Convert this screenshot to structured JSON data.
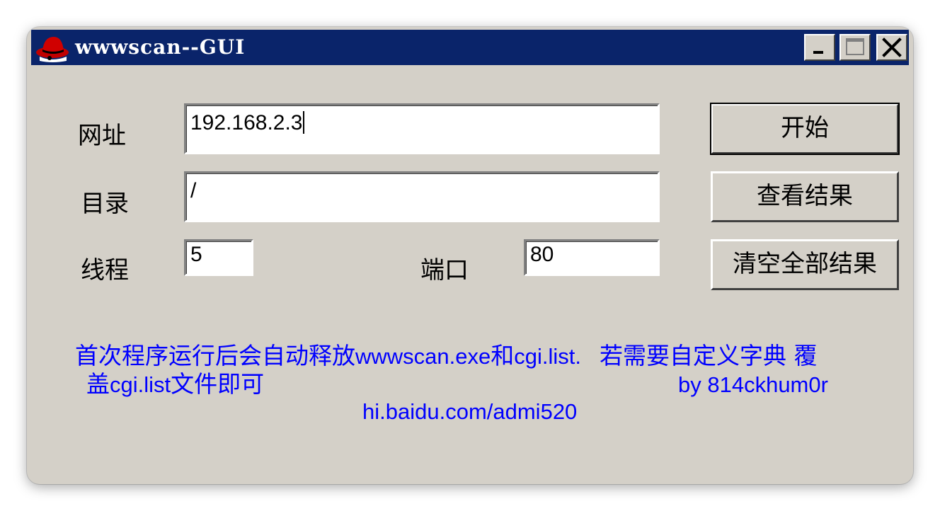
{
  "window": {
    "title": "wwwscan--GUI"
  },
  "form": {
    "url_label": "网址",
    "url_value": "192.168.2.3",
    "dir_label": "目录",
    "dir_value": "/",
    "threads_label": "线程",
    "threads_value": "5",
    "port_label": "端口",
    "port_value": "80"
  },
  "buttons": {
    "start": "开始",
    "view_results": "查看结果",
    "clear_results": "清空全部结果"
  },
  "info": {
    "line1_part1": "首次程序运行后会自动释放",
    "line1_part2": "wwwscan.exe",
    "line1_part3": "和",
    "line1_part4": "cgi.list.",
    "line1_part5": "若需要自定义字典 覆",
    "line2_part1": "盖",
    "line2_part2": "cgi.list",
    "line2_part3": "文件即可",
    "author": "by 814ckhum0r",
    "website": "hi.baidu.com/admi520"
  },
  "icons": {
    "app": "redhat-icon",
    "minimize": "minimize-icon",
    "maximize": "maximize-icon",
    "close": "close-icon"
  },
  "colors": {
    "titlebar": "#0a246a",
    "window_face": "#d4d0c8",
    "info_text": "#0000ff"
  }
}
